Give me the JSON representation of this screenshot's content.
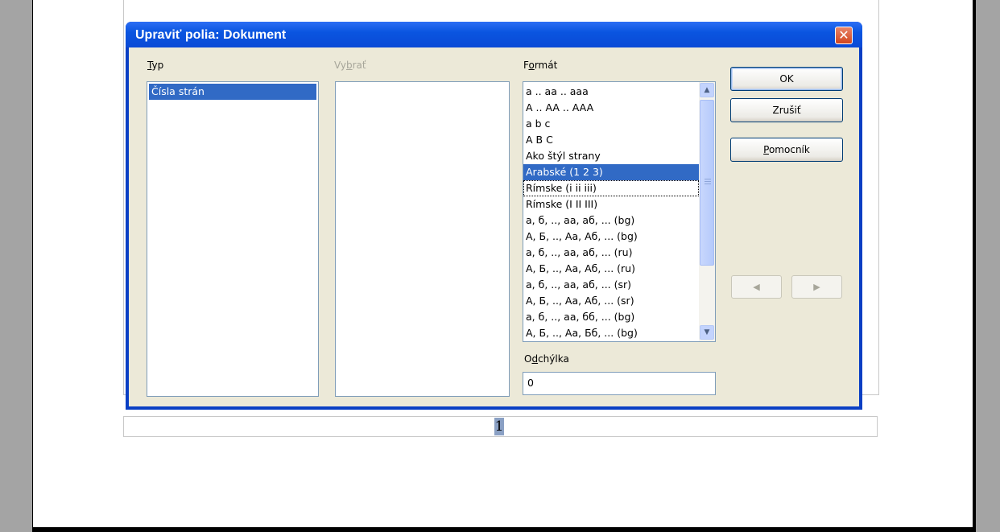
{
  "dialog": {
    "title": "Upraviť polia: Dokument",
    "close_icon": "close-icon"
  },
  "type_column": {
    "label_access": "T",
    "label_rest": "yp",
    "items": [
      {
        "label": "Čísla strán",
        "selected": true
      }
    ]
  },
  "select_column": {
    "label_pre": "Vy",
    "label_access": "b",
    "label_rest": "rať",
    "items": []
  },
  "format_column": {
    "label_pre": "F",
    "label_access": "o",
    "label_rest": "rmát",
    "items": [
      "a .. aa .. aaa",
      "A .. AA .. AAA",
      "a b c",
      "A B C",
      "Ako štýl strany",
      "Arabské (1 2 3)",
      "Rímske (i ii iii)",
      "Rímske (I II III)",
      "а, б, .., аа, аб, ... (bg)",
      "А, Б, .., Аа, Аб, ... (bg)",
      "а, б, .., аа, аб, ... (ru)",
      "А, Б, .., Аа, Аб, ... (ru)",
      "а, б, .., аа, аб, ... (sr)",
      "А, Б, .., Аа, Аб, ... (sr)",
      "а, б, .., аа, бб, ... (bg)",
      "А, Б, .., Аа, Бб, ... (bg)"
    ],
    "selected_index": 5,
    "focused_index": 6
  },
  "offset": {
    "label_pre": "O",
    "label_access": "d",
    "label_rest": "chýlka",
    "value": "0"
  },
  "buttons": {
    "ok": "OK",
    "cancel": "Zrušiť",
    "help_access": "P",
    "help_rest": "omocník",
    "prev_icon": "◀",
    "next_icon": "▶"
  },
  "document": {
    "page_number": "1"
  },
  "colors": {
    "titlebar": "#0a55e0",
    "selection": "#316ac5",
    "dialog_face": "#ece9d8"
  }
}
